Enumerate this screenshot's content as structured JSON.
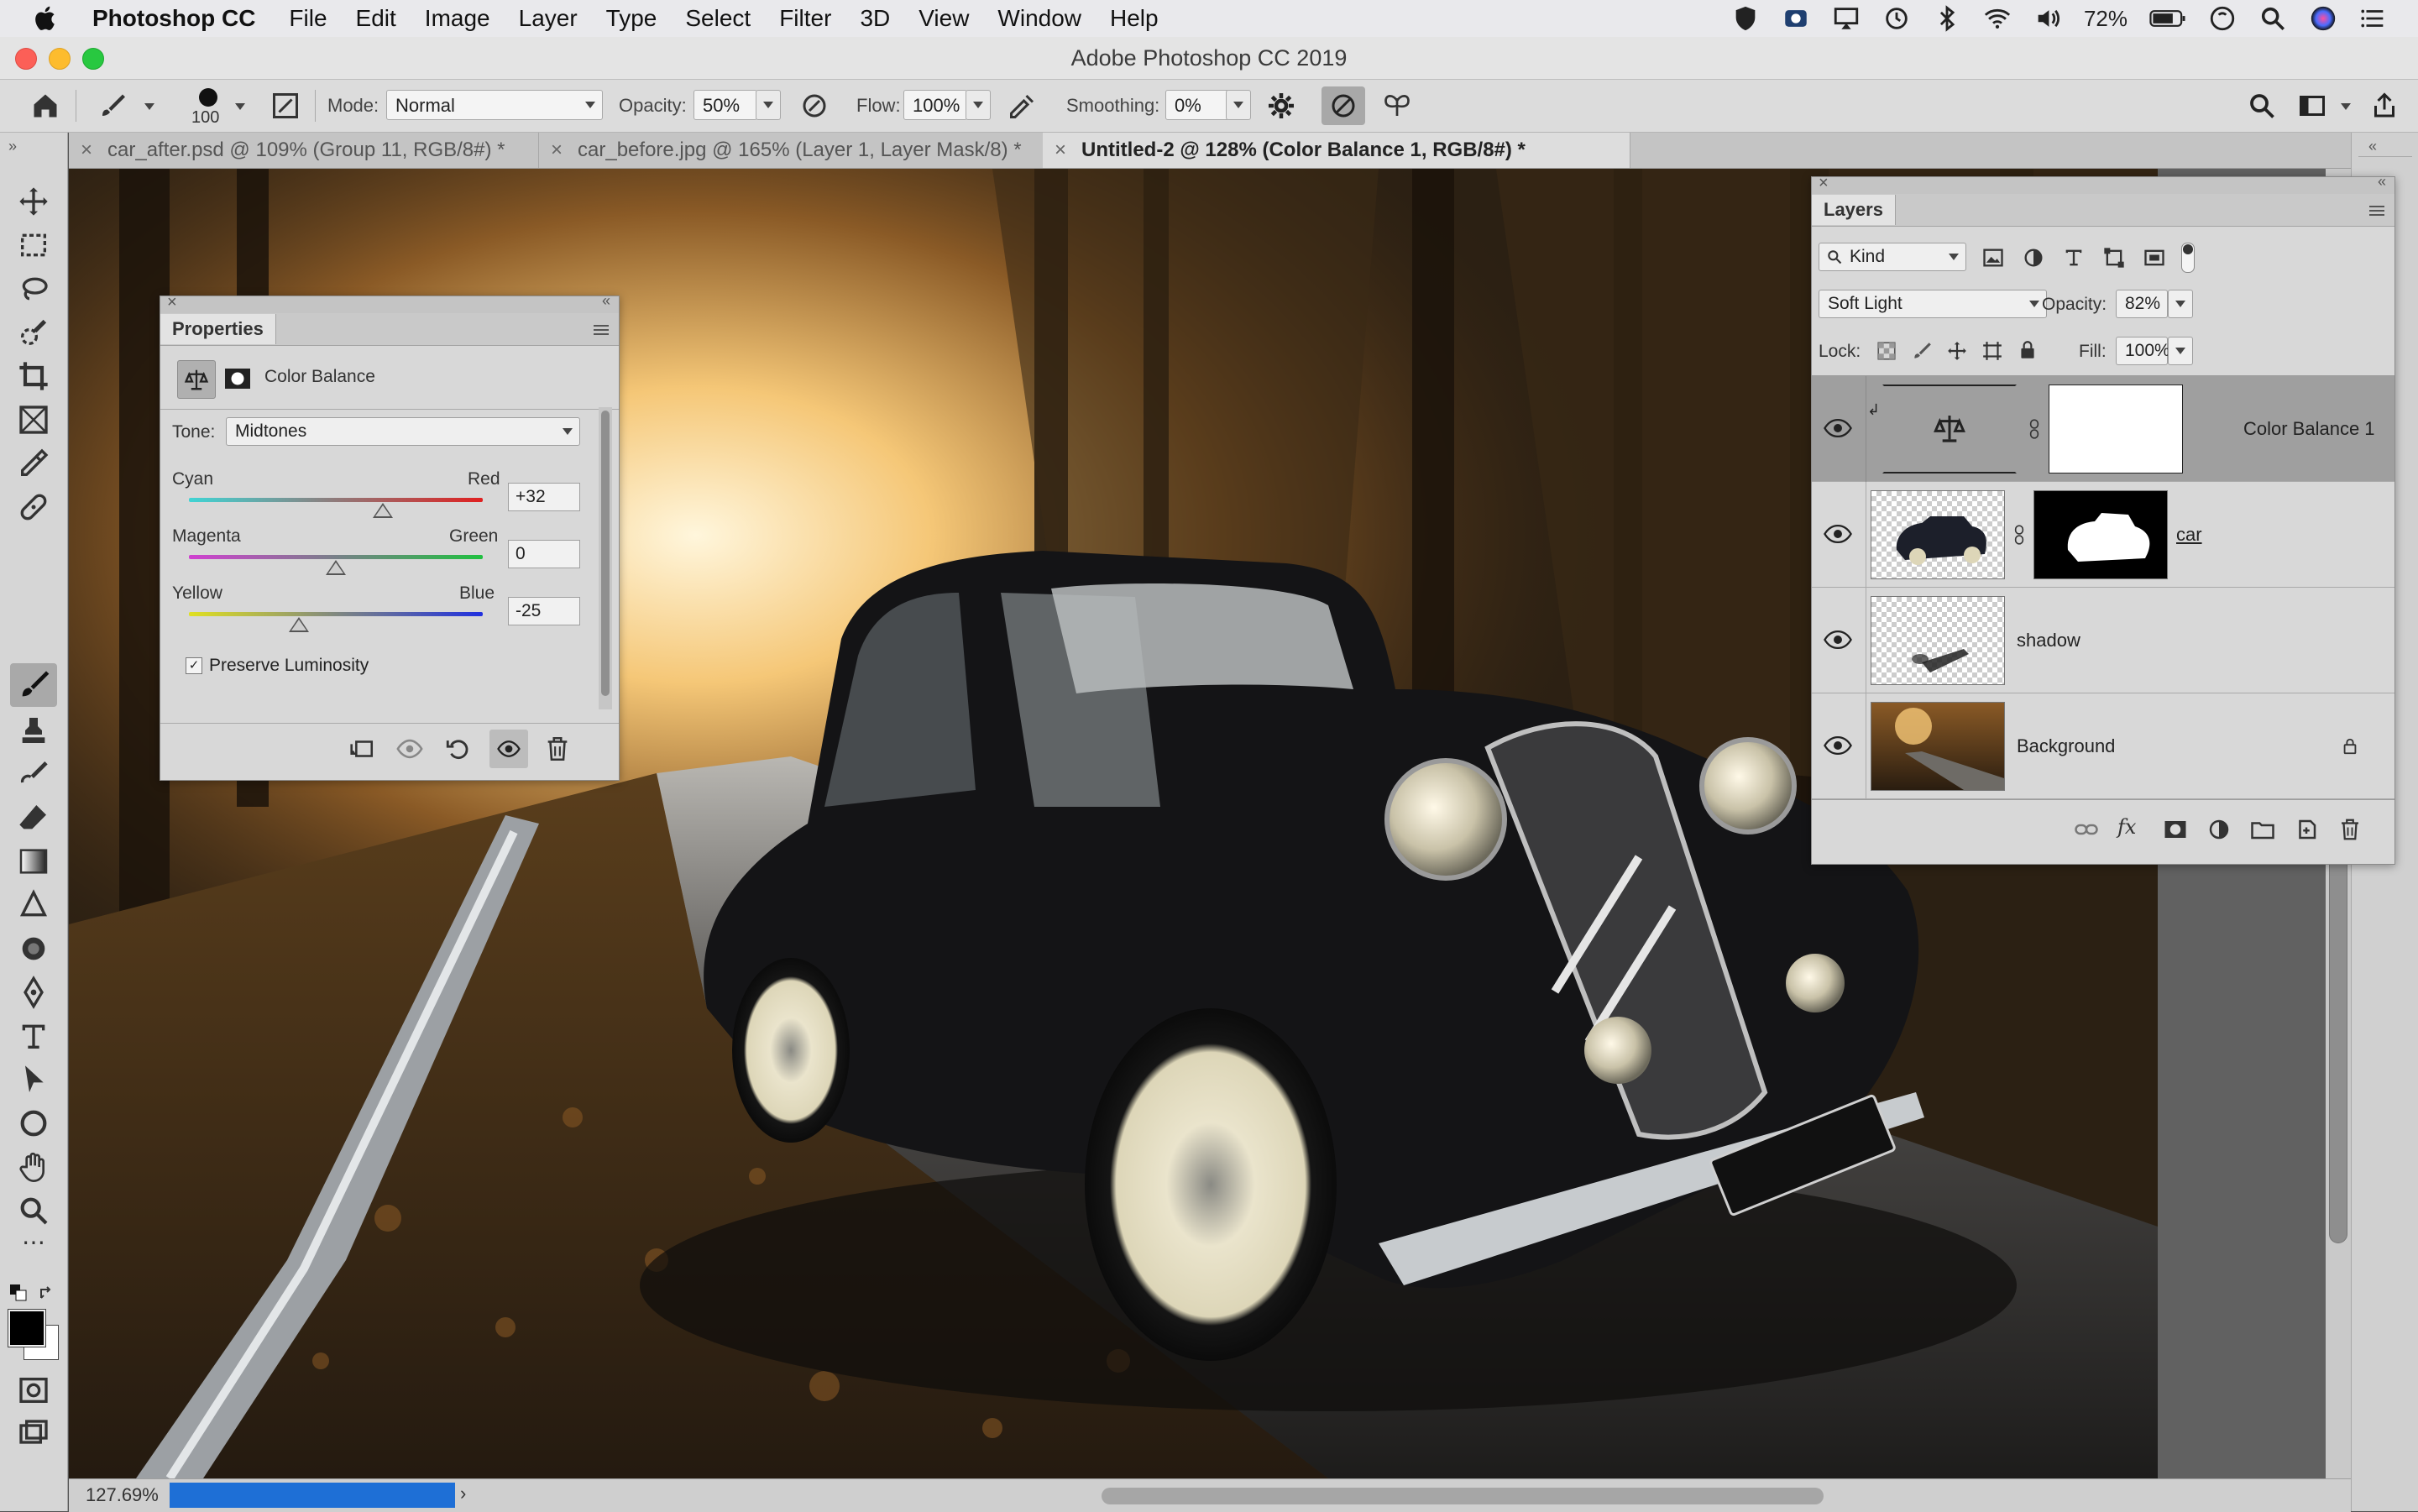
{
  "menubar": {
    "app_name": "Photoshop CC",
    "items": [
      "File",
      "Edit",
      "Image",
      "Layer",
      "Type",
      "Select",
      "Filter",
      "3D",
      "View",
      "Window",
      "Help"
    ],
    "battery": "72%"
  },
  "window": {
    "title": "Adobe Photoshop CC 2019"
  },
  "options": {
    "brush_size": "100",
    "mode_label": "Mode:",
    "mode_value": "Normal",
    "opacity_label": "Opacity:",
    "opacity_value": "50%",
    "flow_label": "Flow:",
    "flow_value": "100%",
    "smoothing_label": "Smoothing:",
    "smoothing_value": "0%"
  },
  "tabs": [
    {
      "label": "car_after.psd @ 109% (Group 11, RGB/8#) *"
    },
    {
      "label": "car_before.jpg @ 165% (Layer 1, Layer Mask/8) *"
    },
    {
      "label": "Untitled-2 @ 128% (Color Balance 1, RGB/8#) *"
    }
  ],
  "status": {
    "zoom": "127.69%"
  },
  "properties": {
    "tab_label": "Properties",
    "adjustment_name": "Color Balance",
    "tone_label": "Tone:",
    "tone_value": "Midtones",
    "sliders": [
      {
        "left": "Cyan",
        "right": "Red",
        "value": "+32",
        "level": 32
      },
      {
        "left": "Magenta",
        "right": "Green",
        "value": "0",
        "level": 0
      },
      {
        "left": "Yellow",
        "right": "Blue",
        "value": "-25",
        "level": -25
      }
    ],
    "preserve_luminosity_label": "Preserve Luminosity",
    "preserve_luminosity_checked": true
  },
  "layers": {
    "tab_label": "Layers",
    "filter_label": "Kind",
    "blend_mode": "Soft Light",
    "opacity_label": "Opacity:",
    "opacity_value": "82%",
    "lock_label": "Lock:",
    "fill_label": "Fill:",
    "fill_value": "100%",
    "rows": [
      {
        "name": "Color Balance 1"
      },
      {
        "name": "car"
      },
      {
        "name": "shadow"
      },
      {
        "name": "Background"
      }
    ]
  },
  "colors": {
    "ui_light": "#d8d8d8",
    "selected_row": "#9f9f9f",
    "accent_blue": "#1e6fd6",
    "slider_cyan": "#3fd4d4",
    "slider_red": "#e02020",
    "slider_magenta": "#d040d0",
    "slider_green": "#20c040",
    "slider_yellow": "#e0e020",
    "slider_blue": "#2030e0"
  }
}
